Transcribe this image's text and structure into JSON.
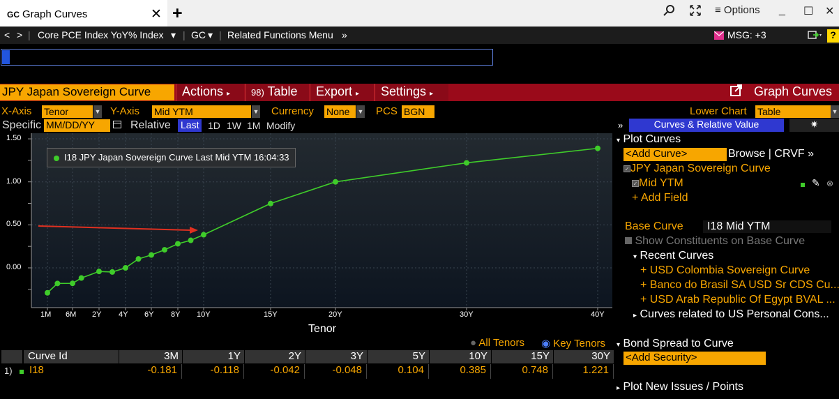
{
  "tab": {
    "badge": "GC",
    "title": "Graph Curves",
    "close": "✕",
    "new": "+"
  },
  "window": {
    "options_label": "≡ Options",
    "minimize": "_",
    "maximize": "☐",
    "close": "✕"
  },
  "nav": {
    "back": "<",
    "forward": ">",
    "security": "Core PCE Index YoY% Index",
    "function": "GC",
    "related": "Related Functions Menu",
    "msg": "MSG: +3",
    "help": "?"
  },
  "toolbar": {
    "curve_title": "JPY Japan Sovereign Curve",
    "actions": "Actions",
    "table_num": "98)",
    "table": "Table",
    "export": "Export",
    "settings": "Settings",
    "graph_curves": "Graph Curves"
  },
  "axis_row": {
    "x_label": "X-Axis",
    "x_value": "Tenor",
    "y_label": "Y-Axis",
    "y_value": "Mid YTM",
    "currency_label": "Currency",
    "currency_value": "None",
    "pcs_label": "PCS",
    "pcs_value": "BGN",
    "lower_chart_label": "Lower Chart",
    "lower_chart_value": "Table"
  },
  "spec_row": {
    "specific": "Specific",
    "date_placeholder": "MM/DD/YY",
    "relative": "Relative",
    "last": "Last",
    "d1": "1D",
    "w1": "1W",
    "m1": "1M",
    "modify": "Modify"
  },
  "legend": "I18 JPY Japan Sovereign Curve Last Mid YTM 16:04:33",
  "chart_data": {
    "type": "line",
    "title": "",
    "xlabel": "Tenor",
    "ylabel": "",
    "ylim": [
      -0.45,
      1.55
    ],
    "yticks": [
      {
        "v": 1.5,
        "label": "1.50"
      },
      {
        "v": 1.0,
        "label": "1.00"
      },
      {
        "v": 0.5,
        "label": "0.50"
      },
      {
        "v": 0.0,
        "label": "0.00"
      }
    ],
    "xticks": [
      {
        "m": 1,
        "label": "1M"
      },
      {
        "m": 6,
        "label": "6M"
      },
      {
        "m": 24,
        "label": "2Y"
      },
      {
        "m": 48,
        "label": "4Y"
      },
      {
        "m": 72,
        "label": "6Y"
      },
      {
        "m": 96,
        "label": "8Y"
      },
      {
        "m": 120,
        "label": "10Y"
      },
      {
        "m": 180,
        "label": "15Y"
      },
      {
        "m": 240,
        "label": "20Y"
      },
      {
        "m": 360,
        "label": "30Y"
      },
      {
        "m": 480,
        "label": "40Y"
      }
    ],
    "series": [
      {
        "name": "I18 JPY Japan Sovereign Curve Last Mid YTM",
        "color": "#3fcc2a",
        "points": [
          {
            "m": 1,
            "y": -0.29
          },
          {
            "m": 3,
            "y": -0.181
          },
          {
            "m": 6,
            "y": -0.18
          },
          {
            "m": 12,
            "y": -0.118
          },
          {
            "m": 24,
            "y": -0.042
          },
          {
            "m": 36,
            "y": -0.048
          },
          {
            "m": 48,
            "y": 0.0
          },
          {
            "m": 60,
            "y": 0.104
          },
          {
            "m": 72,
            "y": 0.15
          },
          {
            "m": 84,
            "y": 0.21
          },
          {
            "m": 96,
            "y": 0.28
          },
          {
            "m": 108,
            "y": 0.32
          },
          {
            "m": 120,
            "y": 0.385
          },
          {
            "m": 180,
            "y": 0.748
          },
          {
            "m": 240,
            "y": 1.0
          },
          {
            "m": 360,
            "y": 1.221
          },
          {
            "m": 480,
            "y": 1.39
          }
        ]
      }
    ],
    "annotation_arrow_color": "#e03020"
  },
  "tenor_toggle": {
    "all": "All Tenors",
    "key": "Key Tenors"
  },
  "table": {
    "headers": [
      "Curve Id",
      "3M",
      "1Y",
      "2Y",
      "3Y",
      "5Y",
      "10Y",
      "15Y",
      "30Y"
    ],
    "row_num": "1)",
    "curve_id": "I18",
    "values": [
      "-0.181",
      "-0.118",
      "-0.042",
      "-0.048",
      "0.104",
      "0.385",
      "0.748",
      "1.221"
    ]
  },
  "panel": {
    "expand": "»",
    "header": "Curves & Relative Value",
    "gear": "✷",
    "plot_curves": "Plot Curves",
    "add_curve": "<Add Curve>",
    "browse": "Browse | CRVF »",
    "curve_name": "JPY Japan Sovereign Curve",
    "field_mid": "Mid YTM",
    "add_field": "+ Add Field",
    "base_curve_label": "Base Curve",
    "base_curve_value": "I18 Mid YTM",
    "show_constituents": "Show Constituents on Base Curve",
    "recent_curves": "Recent Curves",
    "recent": [
      "+ USD Colombia Sovereign Curve",
      "+ Banco do Brasil SA USD Sr CDS Cu...",
      "+ USD Arab Republic Of Egypt BVAL ..."
    ],
    "related": "Curves related to US Personal Cons...",
    "bond_spread": "Bond Spread to Curve",
    "add_security": "<Add Security>",
    "plot_new": "Plot New Issues / Points"
  }
}
